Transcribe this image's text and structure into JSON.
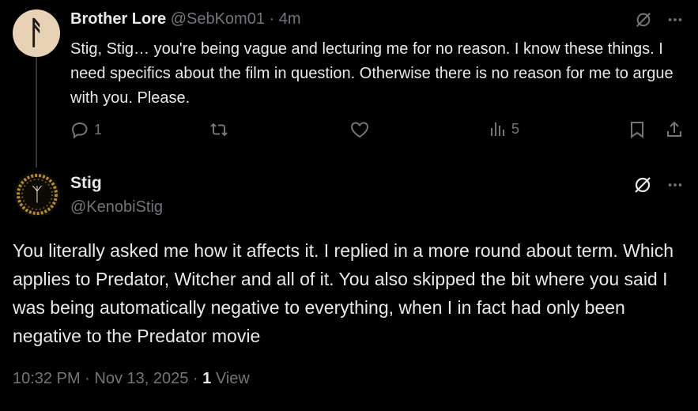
{
  "reply": {
    "display_name": "Brother Lore",
    "handle": "@SebKom01",
    "separator": "·",
    "time_ago": "4m",
    "text": "Stig, Stig… you're being vague and lecturing me for no reason. I know these things. I need specifics about the film in question. Otherwise there is no reason for me to argue with you. Please.",
    "replies_count": "1",
    "views_count": "5",
    "avatar_letter": "ᚨ"
  },
  "main_post": {
    "display_name": "Stig",
    "handle": "@KenobiStig",
    "text": "You literally asked me how it affects it. I replied in a more round about term. Which applies to Predator, Witcher and all of it. You also skipped the bit where you said I was being automatically negative to everything, when I in fact had only been negative to the Predator movie",
    "avatar_glyph": "ᛉ",
    "timestamp": "10:32 PM · Nov 13, 2025 · ",
    "views_number": "1",
    "views_label": " View"
  },
  "icons": [
    "grok-icon",
    "more-icon",
    "reply-icon",
    "repost-icon",
    "like-icon",
    "views-icon",
    "bookmark-icon",
    "share-icon"
  ],
  "colors": {
    "background": "#000000",
    "text": "#e7e9ea",
    "muted": "#71767b",
    "thread_line": "#333639"
  }
}
